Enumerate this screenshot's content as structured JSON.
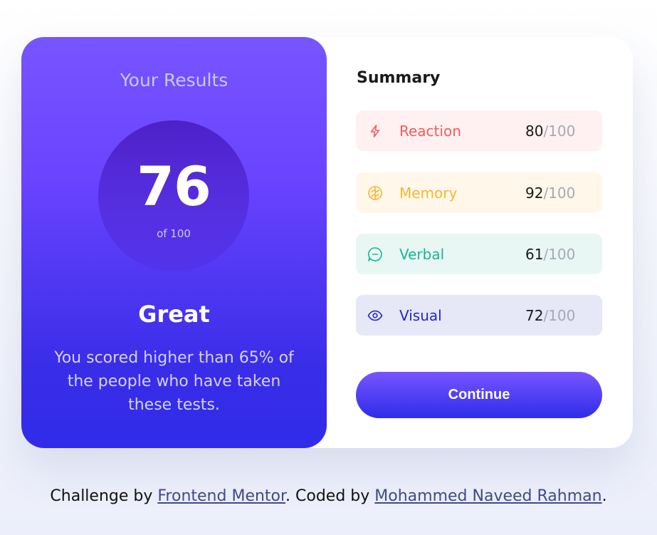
{
  "results": {
    "title": "Your Results",
    "score": "76",
    "score_of": "of 100",
    "rating": "Great",
    "description": "You scored higher than 65% of the people who have taken these tests."
  },
  "summary": {
    "title": "Summary",
    "items": [
      {
        "icon": "lightning-icon",
        "label": "Reaction",
        "score": "80",
        "total": "/100",
        "color": "#f05d5d"
      },
      {
        "icon": "brain-icon",
        "label": "Memory",
        "score": "92",
        "total": "/100",
        "color": "#f5b633"
      },
      {
        "icon": "speech-bubble-icon",
        "label": "Verbal",
        "score": "61",
        "total": "/100",
        "color": "#16b890"
      },
      {
        "icon": "eye-icon",
        "label": "Visual",
        "score": "72",
        "total": "/100",
        "color": "#2525c5"
      }
    ],
    "continue_label": "Continue"
  },
  "attribution": {
    "prefix": "Challenge by ",
    "mentor_link": "Frontend Mentor",
    "middle": ". Coded by ",
    "author_link": "Mohammed Naveed Rahman",
    "suffix": "."
  },
  "colors": {
    "accent_start": "#7755ff",
    "accent_end": "#2f2ce9"
  }
}
